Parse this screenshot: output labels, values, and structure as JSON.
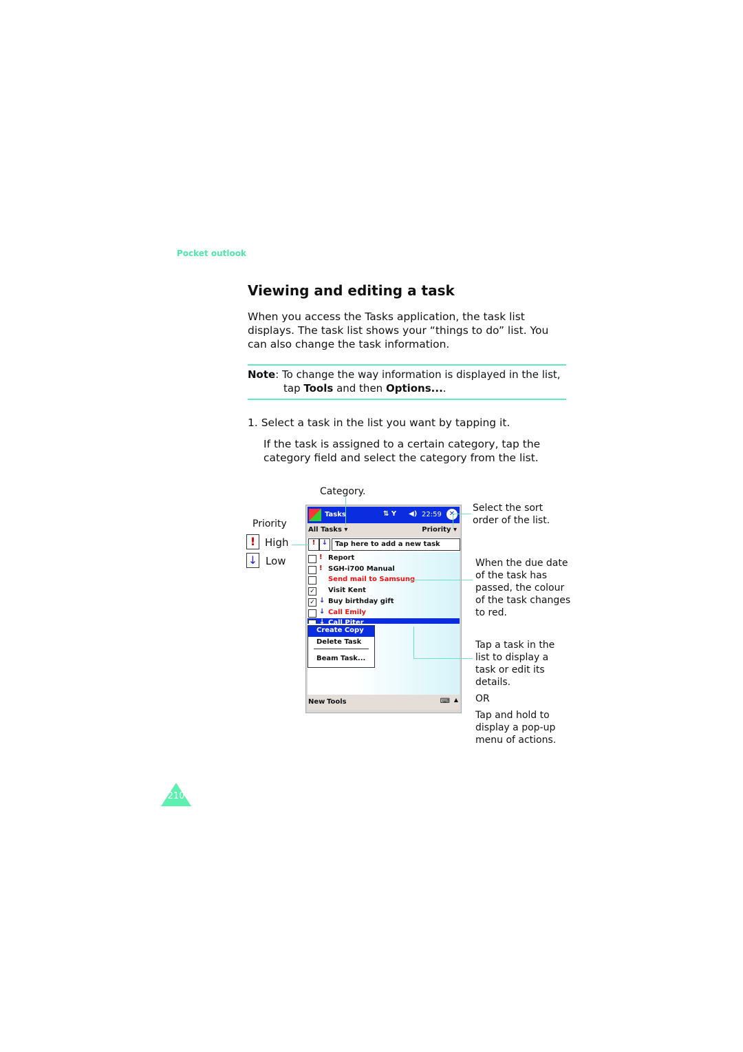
{
  "section": "Pocket outlook",
  "title": "Viewing and editing a task",
  "intro": "When you access the Tasks application, the task list displays. The task list shows your “things to do” list. You can also change the task information.",
  "note": {
    "label": "Note",
    "text1": ": To change the way information is displayed in the list,",
    "text2a": "tap ",
    "tools": "Tools",
    "text2b": " and then ",
    "options": "Options...",
    "text2c": "."
  },
  "step1": "1. Select a task in the list you want by tapping it.",
  "step1_detail": "If the task is assigned to a certain category, tap the category field and select the category from the list.",
  "annotations": {
    "category": "Category.",
    "priority": "Priority",
    "high": "High",
    "low": "Low",
    "sort": "Select the sort order of the list.",
    "due": "When the due date of the task has passed, the colour of the task changes to red.",
    "tap": "Tap a task in the list to display a task or edit its details.",
    "or": "OR",
    "hold": "Tap and hold to display a pop-up menu of actions."
  },
  "device": {
    "app": "Tasks",
    "time": "22:59",
    "category": "All Tasks",
    "sort": "Priority",
    "new_task": "Tap here to add a new task",
    "tasks": [
      {
        "name": "Report",
        "pri": "!",
        "done": false,
        "overdue": false
      },
      {
        "name": "SGH-i700 Manual",
        "pri": "!",
        "done": false,
        "overdue": false
      },
      {
        "name": "Send mail to Samsung",
        "pri": "",
        "done": false,
        "overdue": true
      },
      {
        "name": "Visit Kent",
        "pri": "",
        "done": true,
        "overdue": false
      },
      {
        "name": "Buy birthday gift",
        "pri": "↓",
        "done": true,
        "overdue": false
      },
      {
        "name": "Call Emily",
        "pri": "↓",
        "done": false,
        "overdue": true
      },
      {
        "name": "Call Piter",
        "pri": "↓",
        "done": false,
        "overdue": false
      }
    ],
    "menu": [
      "Create Copy",
      "Delete Task",
      "Beam Task..."
    ],
    "bottom": {
      "new": "New",
      "tools": "Tools"
    }
  },
  "page_number": "210",
  "colors": {
    "accent": "#4fe8a8",
    "titlebar": "#0a2de0",
    "overdue": "#ee1111"
  }
}
